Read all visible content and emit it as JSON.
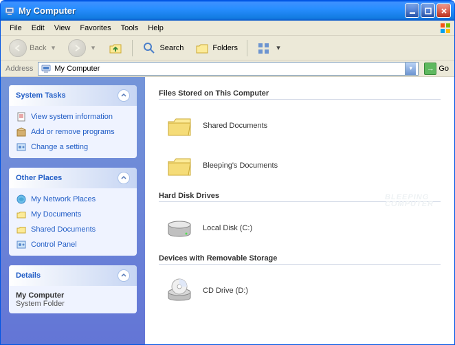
{
  "window": {
    "title": "My Computer"
  },
  "menu": {
    "file": "File",
    "edit": "Edit",
    "view": "View",
    "favorites": "Favorites",
    "tools": "Tools",
    "help": "Help"
  },
  "toolbar": {
    "back": "Back",
    "search": "Search",
    "folders": "Folders"
  },
  "address": {
    "label": "Address",
    "value": "My Computer",
    "go": "Go"
  },
  "sidebar": {
    "system_tasks": {
      "title": "System Tasks",
      "items": [
        {
          "label": "View system information"
        },
        {
          "label": "Add or remove programs"
        },
        {
          "label": "Change a setting"
        }
      ]
    },
    "other_places": {
      "title": "Other Places",
      "items": [
        {
          "label": "My Network Places"
        },
        {
          "label": "My Documents"
        },
        {
          "label": "Shared Documents"
        },
        {
          "label": "Control Panel"
        }
      ]
    },
    "details": {
      "title": "Details",
      "name": "My Computer",
      "type": "System Folder"
    }
  },
  "main": {
    "sections": [
      {
        "heading": "Files Stored on This Computer",
        "items": [
          {
            "label": "Shared Documents",
            "icon": "folder"
          },
          {
            "label": "Bleeping's Documents",
            "icon": "folder"
          }
        ]
      },
      {
        "heading": "Hard Disk Drives",
        "items": [
          {
            "label": "Local Disk (C:)",
            "icon": "hdd"
          }
        ]
      },
      {
        "heading": "Devices with Removable Storage",
        "items": [
          {
            "label": "CD Drive (D:)",
            "icon": "cd"
          }
        ]
      }
    ],
    "watermark1": "BLEEPING",
    "watermark2": "COMPUTER"
  }
}
